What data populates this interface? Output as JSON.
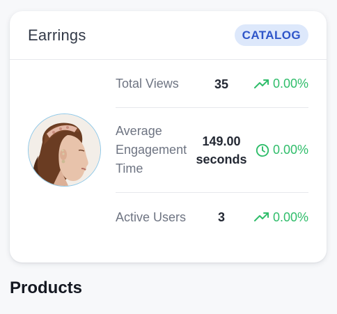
{
  "card": {
    "title": "Earrings",
    "badge": "CATALOG",
    "image_alt": "Woman wearing earrings"
  },
  "metrics": [
    {
      "label": "Total Views",
      "value": "35",
      "change": "0.00%",
      "icon": "trending-up-icon"
    },
    {
      "label": "Average Engagement Time",
      "value": "149.00 seconds",
      "change": "0.00%",
      "icon": "clock-icon"
    },
    {
      "label": "Active Users",
      "value": "3",
      "change": "0.00%",
      "icon": "trending-up-icon"
    }
  ],
  "section": {
    "title": "Products"
  },
  "colors": {
    "positive": "#2fbd6a",
    "badge_bg": "#dde8fb",
    "badge_text": "#2e55c9"
  }
}
